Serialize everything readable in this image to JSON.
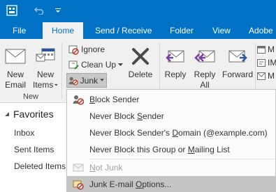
{
  "colors": {
    "accent": "#0072c6",
    "ribbon_bg": "#f0f0f0",
    "menu_highlight": "#c5c5c5",
    "disabled_text": "#a0a0a0"
  },
  "quick_access": {
    "send_receive_icon": "send-receive-icon",
    "undo_icon": "undo-icon",
    "customize_icon": "chevron-down-icon"
  },
  "tabs": [
    "File",
    "Home",
    "Send / Receive",
    "Folder",
    "View",
    "Adobe"
  ],
  "ribbon": {
    "new_group": {
      "new_email": [
        "New",
        "Email"
      ],
      "new_items": [
        "New",
        "Items"
      ],
      "label": "New"
    },
    "delete_group": {
      "ignore": "Ignore",
      "clean_up": "Clean Up",
      "junk": "Junk",
      "delete": "Delete"
    },
    "respond_group": {
      "reply": "Reply",
      "reply_all": [
        "Reply",
        "All"
      ],
      "forward": "Forward"
    },
    "more": {
      "letters": [
        "M",
        "IM",
        "M"
      ]
    }
  },
  "nav": {
    "favorites": "Favorites",
    "items": [
      "Inbox",
      "Sent Items",
      "Deleted Items"
    ]
  },
  "junk_menu": {
    "block_sender": [
      "B",
      "lock Sender"
    ],
    "never_block_sender": [
      "Never Block ",
      "S",
      "ender"
    ],
    "never_block_domain": [
      "Never Block Sender's ",
      "D",
      "omain (@example.com)"
    ],
    "never_block_group": [
      "Never Block this Group or ",
      "M",
      "ailing List"
    ],
    "not_junk": [
      "N",
      "ot Junk"
    ],
    "options": [
      "Junk E-mail ",
      "O",
      "ptions..."
    ]
  }
}
